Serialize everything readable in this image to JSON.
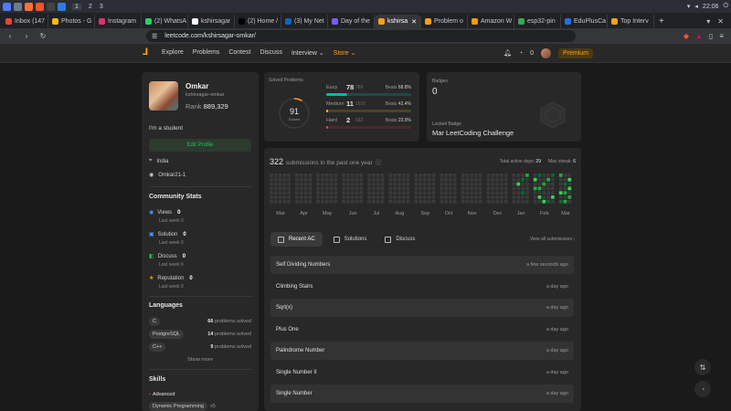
{
  "os": {
    "workspaces": [
      "1",
      "2",
      "3"
    ],
    "clock": "22:06"
  },
  "tabs": [
    {
      "label": "Inbox (147",
      "color": "#ea4335"
    },
    {
      "label": "Photos - G",
      "color": "#fbbc04"
    },
    {
      "label": "Instagram",
      "color": "#e1306c"
    },
    {
      "label": "(2) WhatsA",
      "color": "#25d366"
    },
    {
      "label": "kshirsagar",
      "color": "#ffffff"
    },
    {
      "label": "(2) Home /",
      "color": "#000000"
    },
    {
      "label": "(3) My Net",
      "color": "#0a66c2"
    },
    {
      "label": "Day of the",
      "color": "#7b5cff"
    },
    {
      "label": "kshirsa",
      "color": "#ffa116",
      "active": true
    },
    {
      "label": "Problem o",
      "color": "#ffa116"
    },
    {
      "label": "Amazon W",
      "color": "#ff9900"
    },
    {
      "label": "esp32-pin",
      "color": "#34a853"
    },
    {
      "label": "EduPlusCa",
      "color": "#1f6feb"
    },
    {
      "label": "Top Interv",
      "color": "#ffa116"
    }
  ],
  "address": {
    "url": "leetcode.com/kshirsagar-omkar/"
  },
  "nav": {
    "links": [
      "Explore",
      "Problems",
      "Contest",
      "Discuss",
      "Interview ⌄",
      "Store ⌄"
    ],
    "coins": "0",
    "premium": "Premium"
  },
  "profile": {
    "name": "Omkar",
    "username": "kshirsagar-omkar",
    "rank_label": "Rank",
    "rank": "889,329",
    "bio": "I'm a student",
    "edit": "Edit Profile",
    "location": "India",
    "github": "Omkar21-1"
  },
  "community": {
    "title": "Community Stats",
    "stats": [
      {
        "label": "Views",
        "value": "0",
        "lastweek": "Last week 0",
        "color": "#4a9cff"
      },
      {
        "label": "Solution",
        "value": "0",
        "lastweek": "Last week 0",
        "color": "#4a9cff"
      },
      {
        "label": "Discuss",
        "value": "0",
        "lastweek": "Last week 0",
        "color": "#2cbb5d"
      },
      {
        "label": "Reputation",
        "value": "0",
        "lastweek": "Last week 0",
        "color": "#ffa116"
      }
    ]
  },
  "languages": {
    "title": "Languages",
    "items": [
      {
        "name": "C",
        "count": "66",
        "suffix": "problems solved"
      },
      {
        "name": "PostgreSQL",
        "count": "14",
        "suffix": "problems solved"
      },
      {
        "name": "C++",
        "count": "9",
        "suffix": "problems solved"
      }
    ],
    "show_more": "Show more"
  },
  "skills": {
    "title": "Skills",
    "level": "Advanced",
    "items": [
      {
        "name": "Dynamic Programming",
        "count": "x5"
      }
    ]
  },
  "solved": {
    "label": "Solved Problems",
    "total": "91",
    "total_label": "Solved",
    "beats_label": "Beats",
    "difficulties": [
      {
        "name": "Easy",
        "solved": "78",
        "total": "789",
        "beats": "68.8%",
        "color": "#00b8a3",
        "track": "#1f4a44",
        "fraction": 0.099
      },
      {
        "name": "Medium",
        "solved": "11",
        "total": "1615",
        "beats": "42.4%",
        "color": "#ffc01e",
        "track": "#4d4225",
        "fraction": 0.007
      },
      {
        "name": "Hard",
        "solved": "2",
        "total": "682",
        "beats": "23.9%",
        "color": "#ef4743",
        "track": "#4a2a2a",
        "fraction": 0.003
      }
    ]
  },
  "badges": {
    "label": "Badges",
    "count": "0",
    "locked_label": "Locked Badge",
    "locked_name": "Mar LeetCoding Challenge"
  },
  "heatmap": {
    "count": "322",
    "title": "submissions in the past one year",
    "active_label": "Total active days:",
    "active": "29",
    "streak_label": "Max streak:",
    "streak": "6",
    "months": [
      "Mar",
      "Apr",
      "May",
      "Jun",
      "Jul",
      "Aug",
      "Sep",
      "Oct",
      "Nov",
      "Dec",
      "Jan",
      "Feb",
      "Mar"
    ],
    "empty_color": "#3a3a3a",
    "active_colors": [
      "#0e4429",
      "#006d32",
      "#26a641",
      "#39d353"
    ]
  },
  "recent": {
    "tabs": [
      "Recent AC",
      "Solutions",
      "Discuss"
    ],
    "view_all": "View all submissions  ›",
    "items": [
      {
        "title": "Self Dividing Numbers",
        "ago": "a few seconds ago"
      },
      {
        "title": "Climbing Stairs",
        "ago": "a day ago"
      },
      {
        "title": "Sqrt(x)",
        "ago": "a day ago"
      },
      {
        "title": "Plus One",
        "ago": "a day ago"
      },
      {
        "title": "Palindrome Number",
        "ago": "a day ago"
      },
      {
        "title": "Single Number II",
        "ago": "a day ago"
      },
      {
        "title": "Single Number",
        "ago": "a day ago"
      }
    ]
  }
}
